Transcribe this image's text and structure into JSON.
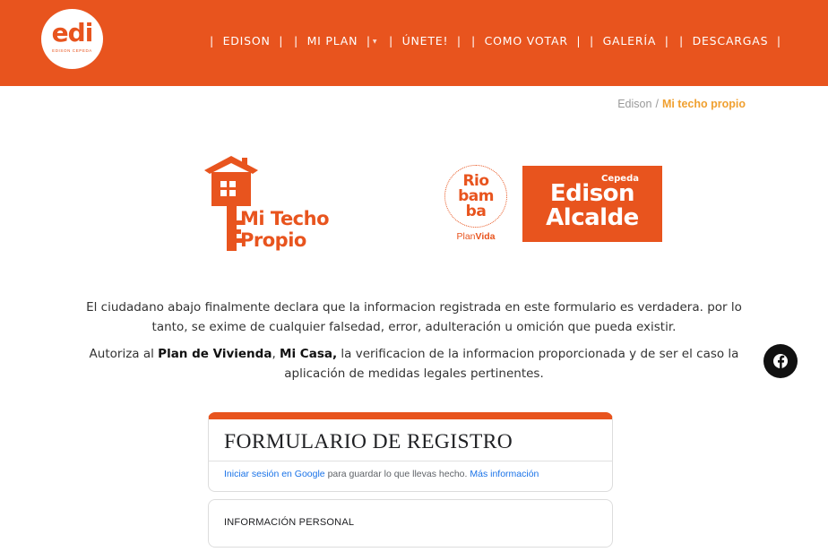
{
  "brand": {
    "logo_text": "edi",
    "logo_subtitle": "EDISON CEPEDA",
    "accent_color": "#e8541e"
  },
  "nav": {
    "separator": "|",
    "items": [
      {
        "label": "EDISON",
        "has_dropdown": false
      },
      {
        "label": "MI PLAN",
        "has_dropdown": true
      },
      {
        "label": "ÚNETE!",
        "has_dropdown": false
      },
      {
        "label": "COMO VOTAR",
        "has_dropdown": false
      },
      {
        "label": "GALERÍA",
        "has_dropdown": false
      },
      {
        "label": "DESCARGAS",
        "has_dropdown": false
      }
    ]
  },
  "breadcrumb": {
    "home": "Edison",
    "separator": "/",
    "current": "Mi techo propio"
  },
  "logos": {
    "mi_techo_line1": "Mi Techo",
    "mi_techo_line2": "Propio",
    "rio_line1": "Rio",
    "rio_line2": "bam",
    "rio_line3": "ba",
    "plan_word": "Plan",
    "vida_word": "Vida",
    "cepeda": "Cepeda",
    "edison": "Edison",
    "alcalde": "Alcalde"
  },
  "declaration": {
    "line1": "El ciudadano abajo finalmente declara que la informacion registrada en este formulario es verdadera. por lo",
    "line2": "tanto, se exime de cualquier falsedad, error, adulteración u omición que pueda existir.",
    "auth_prefix": "Autoriza al ",
    "auth_bold1": "Plan de Vivienda",
    "auth_comma": ", ",
    "auth_bold2": "Mi Casa,",
    "auth_suffix": " la verificacion de la informacion proporcionada y de ser el caso la",
    "line4": "aplicación de medidas legales pertinentes."
  },
  "social": {
    "icon": "facebook-icon",
    "background": "#111111"
  },
  "form": {
    "title": "FORMULARIO DE REGISTRO",
    "signin_link": "Iniciar sesión en Google",
    "signin_middle": " para guardar lo que llevas hecho. ",
    "more_info_link": "Más información",
    "section_title": "INFORMACIÓN PERSONAL"
  }
}
